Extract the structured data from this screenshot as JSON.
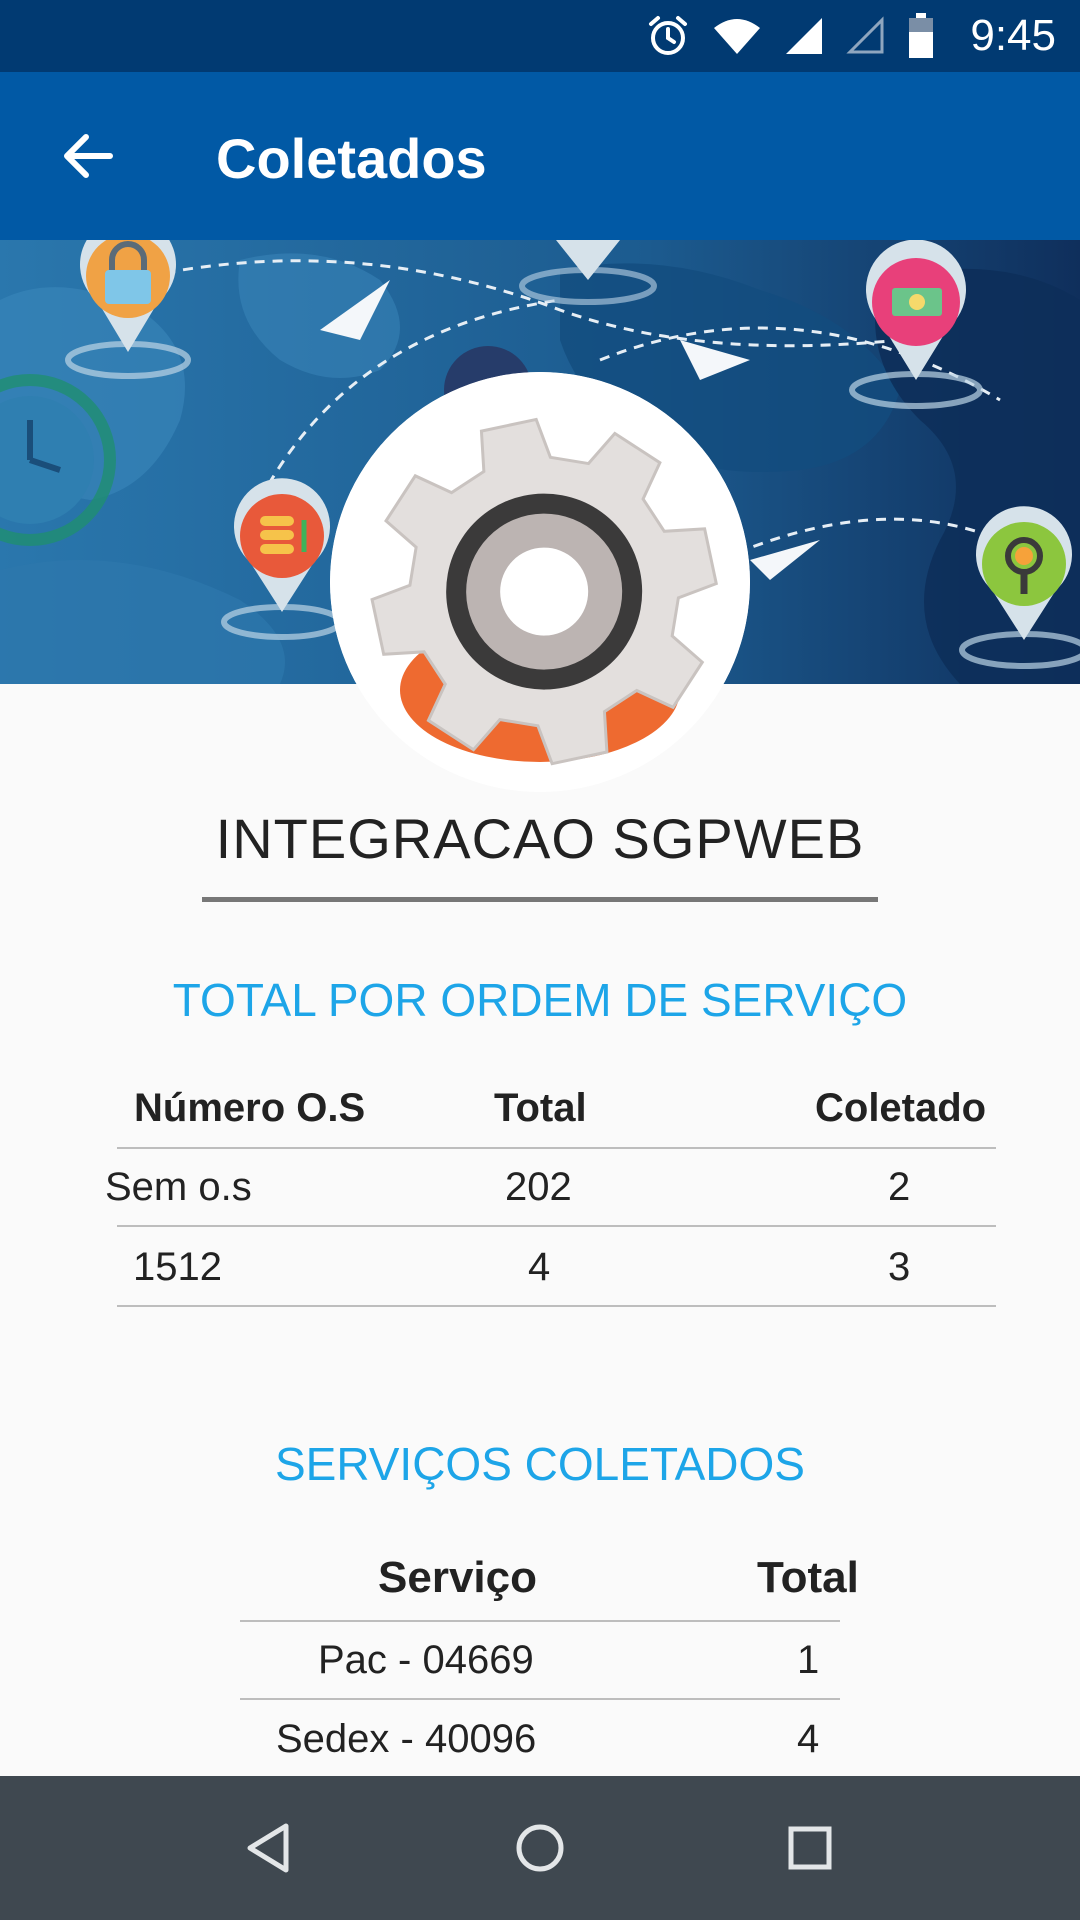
{
  "status_bar": {
    "time": "9:45",
    "icons": [
      "alarm-icon",
      "wifi-icon",
      "signal-icon",
      "signal-empty-icon",
      "battery-icon"
    ]
  },
  "app_bar": {
    "title": "Coletados",
    "back_icon": "arrow-left-icon"
  },
  "company": {
    "name": "INTEGRACAO SGPWEB"
  },
  "os_section": {
    "title": "TOTAL POR ORDEM DE SERVIÇO",
    "headers": [
      "Número O.S",
      "Total",
      "Coletado"
    ],
    "rows": [
      [
        "Sem o.s",
        "202",
        "2"
      ],
      [
        "1512",
        "4",
        "3"
      ]
    ]
  },
  "services_section": {
    "title": "SERVIÇOS COLETADOS",
    "headers": [
      "Serviço",
      "Total"
    ],
    "rows": [
      [
        "Pac - 04669",
        "1"
      ],
      [
        "Sedex - 40096",
        "4"
      ]
    ]
  },
  "nav_bar": {
    "icons": [
      "back-triangle-icon",
      "home-circle-icon",
      "recents-square-icon"
    ]
  },
  "colors": {
    "status_bar": "#013a72",
    "app_bar": "#0159a5",
    "accent": "#1da5e8",
    "nav_bar": "#3f4850"
  }
}
